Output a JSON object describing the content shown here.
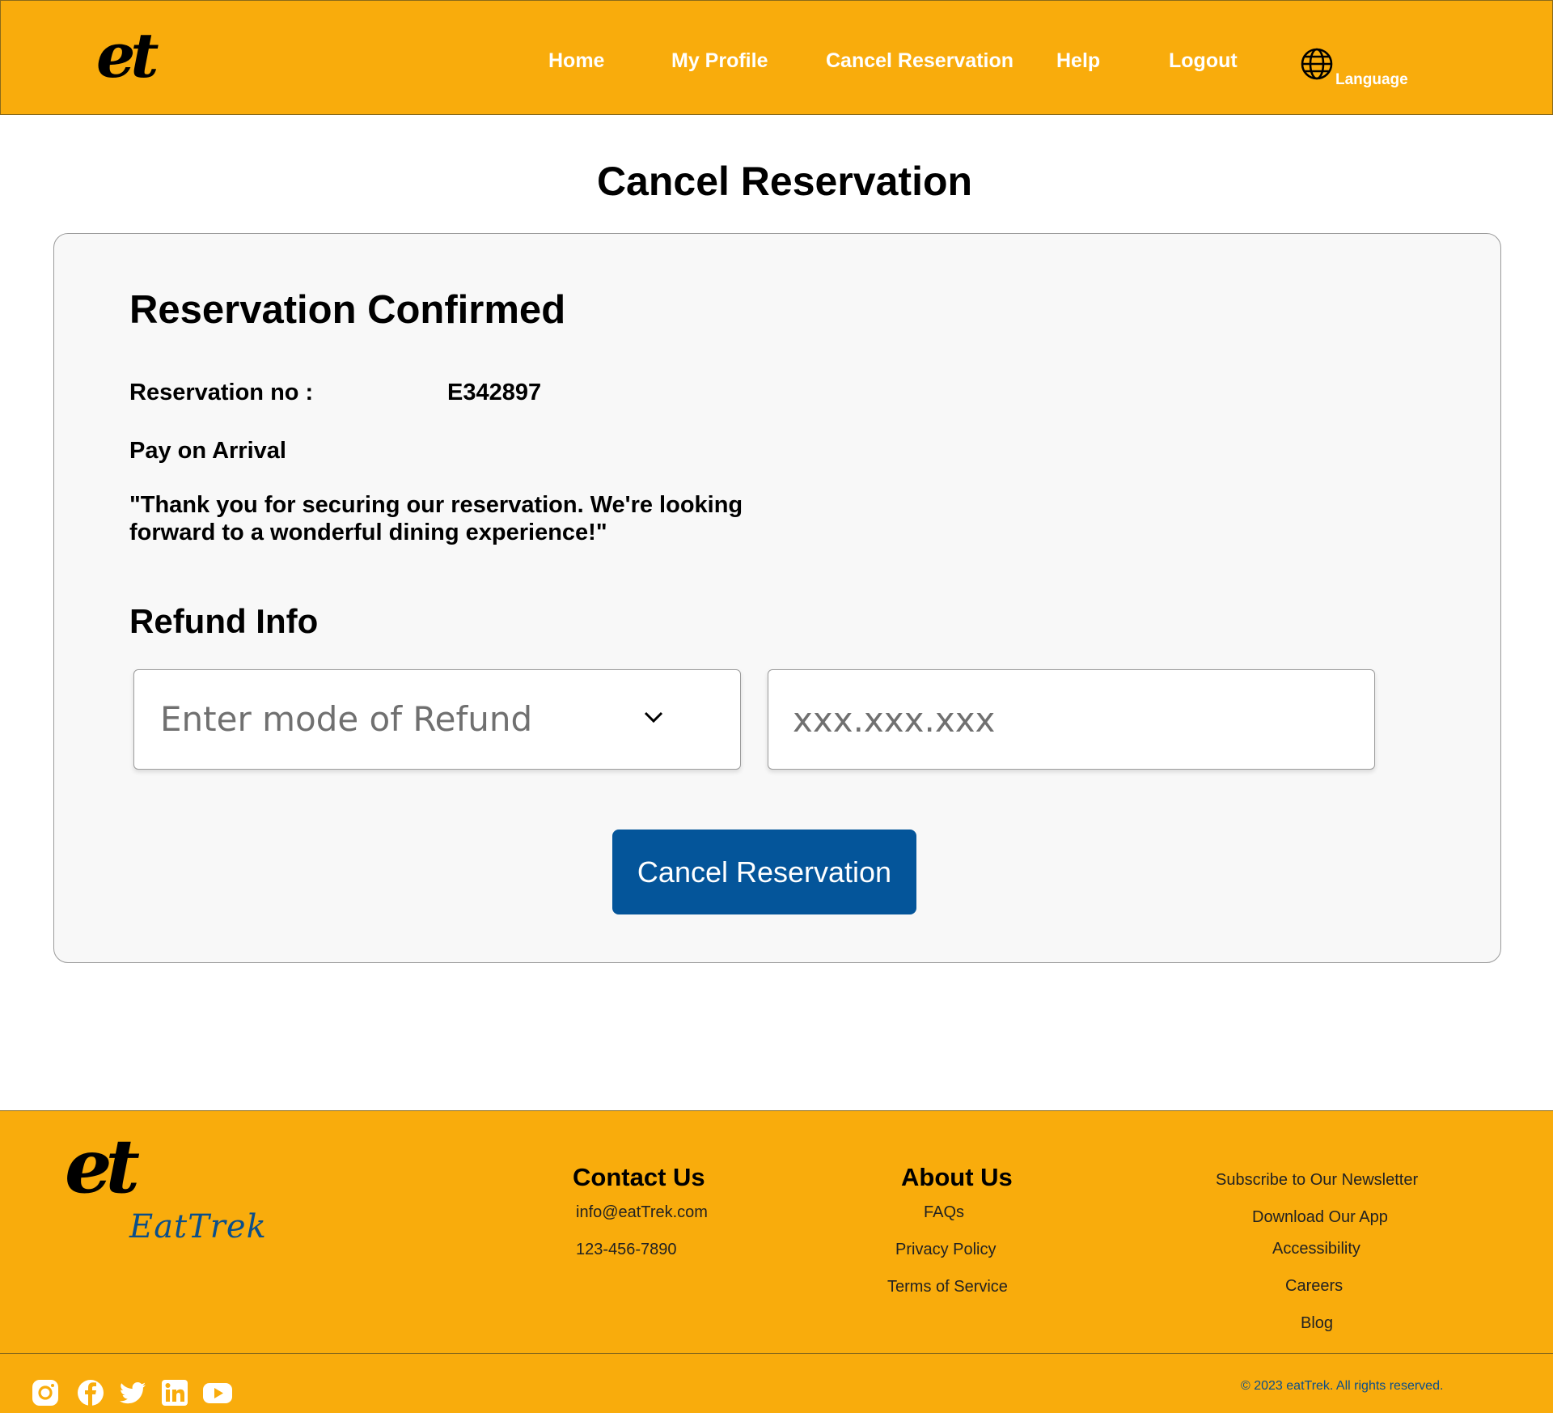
{
  "header": {
    "logo": "et",
    "nav": [
      "Home",
      "My Profile",
      "Cancel Reservation",
      "Help",
      "Logout"
    ],
    "language_label": "Language",
    "bg_color": "#f9ac0c"
  },
  "page": {
    "title": "Cancel Reservation"
  },
  "card": {
    "status_title": "Reservation Confirmed",
    "reservation_label": "Reservation no :",
    "reservation_value": "E342897",
    "payment_method": "Pay on Arrival",
    "thanks_message": "\"Thank you for securing our reservation. We're looking forward to a wonderful dining experience!\"",
    "refund_title": "Refund Info",
    "refund_mode_placeholder": "Enter mode of Refund",
    "account_placeholder": "xxx.xxx.xxx",
    "cancel_button": "Cancel Reservation",
    "button_color": "#04559a"
  },
  "footer": {
    "logo": "et",
    "brand": "EatTrek",
    "contact": {
      "heading": "Contact Us",
      "email": "info@eatTrek.com",
      "phone": "123-456-7890"
    },
    "about": {
      "heading": "About Us",
      "links": [
        "FAQs",
        "Privacy Policy",
        "Terms of Service"
      ]
    },
    "more_links": [
      "Subscribe to Our Newsletter",
      "Download Our App",
      "Accessibility",
      "Careers",
      "Blog"
    ],
    "social_icons": [
      "instagram-icon",
      "facebook-icon",
      "twitter-icon",
      "linkedin-icon",
      "youtube-icon"
    ],
    "copyright": "© 2023 eatTrek. All rights reserved."
  }
}
